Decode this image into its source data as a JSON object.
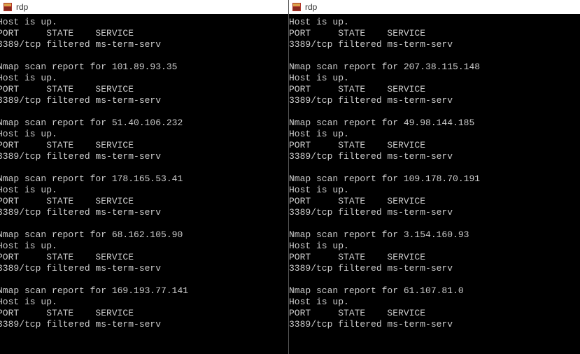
{
  "left": {
    "title": "rdp",
    "blocks": [
      {
        "ip": "",
        "first": true
      },
      {
        "ip": "101.89.93.35"
      },
      {
        "ip": "51.40.106.232"
      },
      {
        "ip": "178.165.53.41"
      },
      {
        "ip": "68.162.105.90"
      },
      {
        "ip": "169.193.77.141"
      }
    ]
  },
  "right": {
    "title": "rdp",
    "blocks": [
      {
        "ip": "",
        "first": true
      },
      {
        "ip": "207.38.115.148"
      },
      {
        "ip": "49.98.144.185"
      },
      {
        "ip": "109.178.70.191"
      },
      {
        "ip": "3.154.160.93"
      },
      {
        "ip": "61.107.81.0"
      }
    ]
  },
  "strings": {
    "scan_prefix": "Nmap scan report for ",
    "host_up": "Host is up.",
    "header": "PORT     STATE    SERVICE",
    "result": "3389/tcp filtered ms-term-serv"
  }
}
